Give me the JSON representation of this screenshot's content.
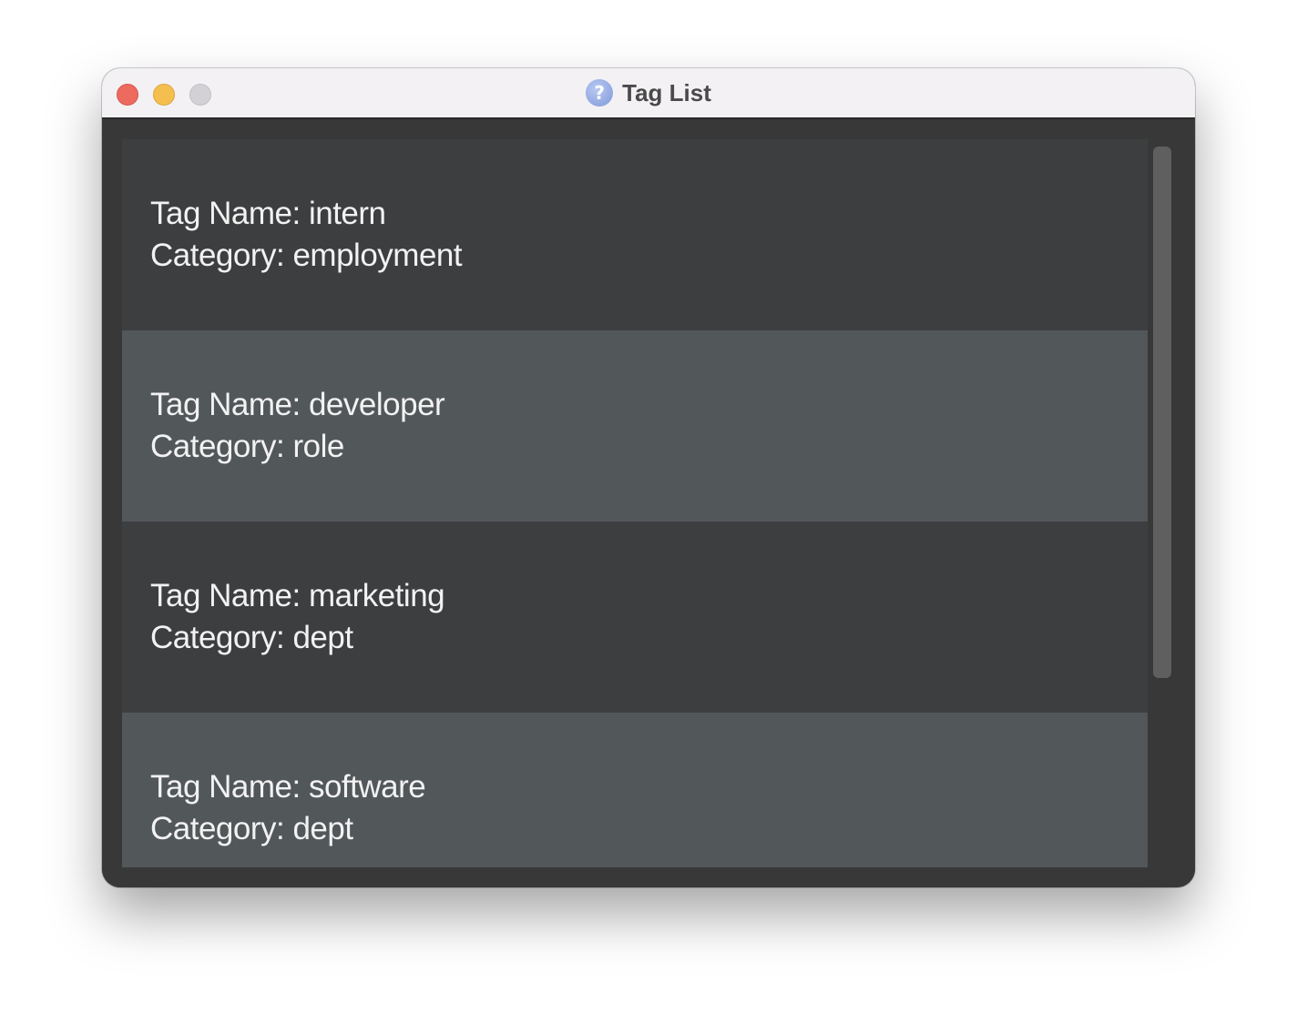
{
  "window": {
    "title": "Tag List",
    "title_icon": "help-icon"
  },
  "tags": [
    {
      "name_line": "Tag Name: intern",
      "category_line": "Category: employment"
    },
    {
      "name_line": "Tag Name: developer",
      "category_line": "Category: role"
    },
    {
      "name_line": "Tag Name: marketing",
      "category_line": "Category: dept"
    },
    {
      "name_line": "Tag Name: software",
      "category_line": "Category: dept"
    }
  ],
  "colors": {
    "row_dark": "#3d3e40",
    "row_light": "#52575a",
    "background": "#383838",
    "text": "#f2f2f2"
  }
}
